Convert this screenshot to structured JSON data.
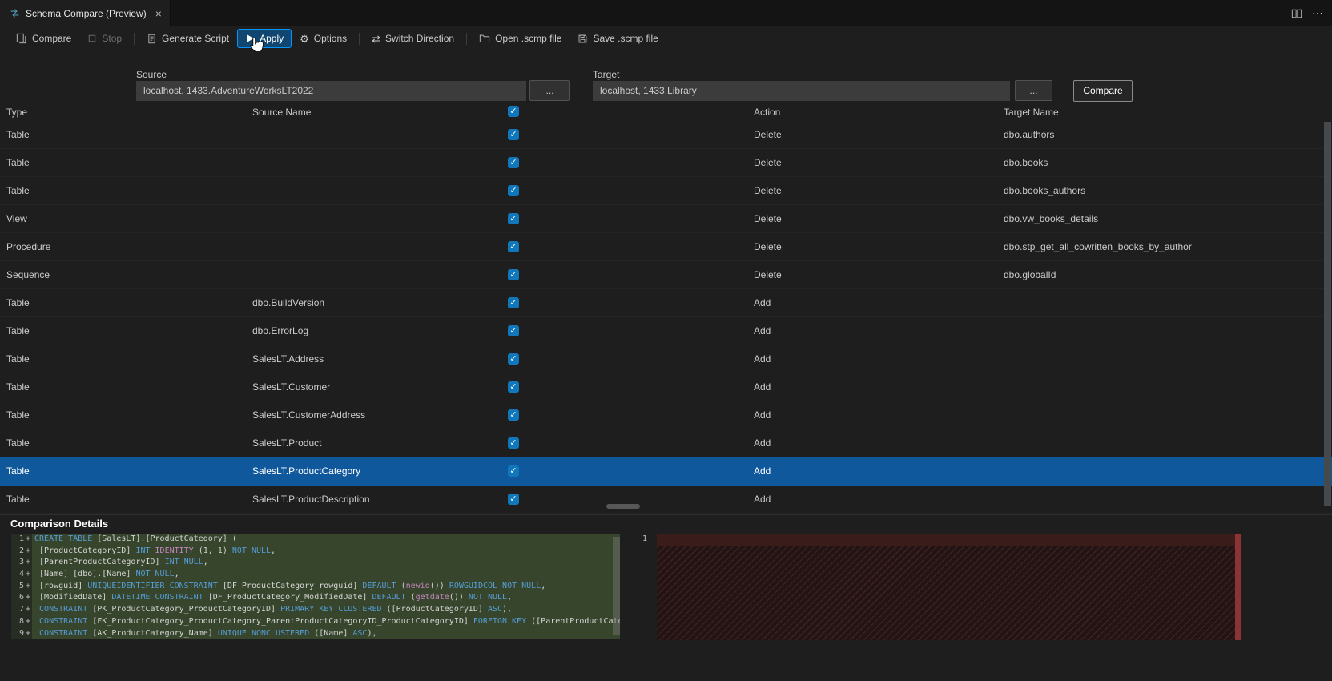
{
  "window": {
    "tab_title": "Schema Compare (Preview)",
    "tab_close": "×",
    "more_actions": "⋯"
  },
  "toolbar": {
    "compare": "Compare",
    "stop": "Stop",
    "generate_script": "Generate Script",
    "apply": "Apply",
    "options": "Options",
    "switch_direction": "Switch Direction",
    "open_scmp": "Open .scmp file",
    "save_scmp": "Save .scmp file"
  },
  "connection": {
    "source_label": "Source",
    "source_value": "localhost, 1433.AdventureWorksLT2022",
    "target_label": "Target",
    "target_value": "localhost, 1433.Library",
    "browse": "...",
    "compare_button": "Compare"
  },
  "grid": {
    "columns": {
      "type": "Type",
      "source": "Source Name",
      "action": "Action",
      "target": "Target Name"
    },
    "rows": [
      {
        "type": "Table",
        "source": "",
        "checked": true,
        "action": "Delete",
        "target": "dbo.authors",
        "selected": false
      },
      {
        "type": "Table",
        "source": "",
        "checked": true,
        "action": "Delete",
        "target": "dbo.books",
        "selected": false
      },
      {
        "type": "Table",
        "source": "",
        "checked": true,
        "action": "Delete",
        "target": "dbo.books_authors",
        "selected": false
      },
      {
        "type": "View",
        "source": "",
        "checked": true,
        "action": "Delete",
        "target": "dbo.vw_books_details",
        "selected": false
      },
      {
        "type": "Procedure",
        "source": "",
        "checked": true,
        "action": "Delete",
        "target": "dbo.stp_get_all_cowritten_books_by_author",
        "selected": false
      },
      {
        "type": "Sequence",
        "source": "",
        "checked": true,
        "action": "Delete",
        "target": "dbo.globalId",
        "selected": false
      },
      {
        "type": "Table",
        "source": "dbo.BuildVersion",
        "checked": true,
        "action": "Add",
        "target": "",
        "selected": false
      },
      {
        "type": "Table",
        "source": "dbo.ErrorLog",
        "checked": true,
        "action": "Add",
        "target": "",
        "selected": false
      },
      {
        "type": "Table",
        "source": "SalesLT.Address",
        "checked": true,
        "action": "Add",
        "target": "",
        "selected": false
      },
      {
        "type": "Table",
        "source": "SalesLT.Customer",
        "checked": true,
        "action": "Add",
        "target": "",
        "selected": false
      },
      {
        "type": "Table",
        "source": "SalesLT.CustomerAddress",
        "checked": true,
        "action": "Add",
        "target": "",
        "selected": false
      },
      {
        "type": "Table",
        "source": "SalesLT.Product",
        "checked": true,
        "action": "Add",
        "target": "",
        "selected": false
      },
      {
        "type": "Table",
        "source": "SalesLT.ProductCategory",
        "checked": true,
        "action": "Add",
        "target": "",
        "selected": true
      },
      {
        "type": "Table",
        "source": "SalesLT.ProductDescription",
        "checked": true,
        "action": "Add",
        "target": "",
        "selected": false
      }
    ]
  },
  "details": {
    "title": "Comparison Details",
    "right_first_line": "1",
    "left_lines": [
      {
        "n": "1",
        "t": [
          [
            "CREATE TABLE",
            "k"
          ],
          [
            " [SalesLT].[ProductCategory] (",
            "d"
          ]
        ]
      },
      {
        "n": "2",
        "t": [
          [
            " [ProductCategoryID] ",
            "d"
          ],
          [
            "INT ",
            "k"
          ],
          [
            "IDENTITY",
            "f"
          ],
          [
            " (1, 1) ",
            "d"
          ],
          [
            "NOT NULL",
            "k"
          ],
          [
            ",",
            "d"
          ]
        ]
      },
      {
        "n": "3",
        "t": [
          [
            " [ParentProductCategoryID] ",
            "d"
          ],
          [
            "INT NULL",
            "k"
          ],
          [
            ",",
            "d"
          ]
        ]
      },
      {
        "n": "4",
        "t": [
          [
            " [Name] [dbo].[Name] ",
            "d"
          ],
          [
            "NOT NULL",
            "k"
          ],
          [
            ",",
            "d"
          ]
        ]
      },
      {
        "n": "5",
        "t": [
          [
            " [rowguid] ",
            "d"
          ],
          [
            "UNIQUEIDENTIFIER CONSTRAINT",
            "k"
          ],
          [
            " [DF_ProductCategory_rowguid] ",
            "d"
          ],
          [
            "DEFAULT",
            "k"
          ],
          [
            " (",
            "d"
          ],
          [
            "newid",
            "f"
          ],
          [
            "()) ",
            "d"
          ],
          [
            "ROWGUIDCOL NOT NULL",
            "k"
          ],
          [
            ",",
            "d"
          ]
        ]
      },
      {
        "n": "6",
        "t": [
          [
            " [ModifiedDate] ",
            "d"
          ],
          [
            "DATETIME CONSTRAINT",
            "k"
          ],
          [
            " [DF_ProductCategory_ModifiedDate] ",
            "d"
          ],
          [
            "DEFAULT",
            "k"
          ],
          [
            " (",
            "d"
          ],
          [
            "getdate",
            "f"
          ],
          [
            "()) ",
            "d"
          ],
          [
            "NOT NULL",
            "k"
          ],
          [
            ",",
            "d"
          ]
        ]
      },
      {
        "n": "7",
        "t": [
          [
            " ",
            "d"
          ],
          [
            "CONSTRAINT",
            "k"
          ],
          [
            " [PK_ProductCategory_ProductCategoryID] ",
            "d"
          ],
          [
            "PRIMARY KEY CLUSTERED",
            "k"
          ],
          [
            " ([ProductCategoryID] ",
            "d"
          ],
          [
            "ASC",
            "k"
          ],
          [
            "),",
            "d"
          ]
        ]
      },
      {
        "n": "8",
        "t": [
          [
            " ",
            "d"
          ],
          [
            "CONSTRAINT",
            "k"
          ],
          [
            " [FK_ProductCategory_ProductCategory_ParentProductCategoryID_ProductCategoryID] ",
            "d"
          ],
          [
            "FOREIGN KEY",
            "k"
          ],
          [
            " ([ParentProductCatego",
            "d"
          ]
        ]
      },
      {
        "n": "9",
        "t": [
          [
            " ",
            "d"
          ],
          [
            "CONSTRAINT",
            "k"
          ],
          [
            " [AK_ProductCategory_Name] ",
            "d"
          ],
          [
            "UNIQUE NONCLUSTERED",
            "k"
          ],
          [
            " ([Name] ",
            "d"
          ],
          [
            "ASC",
            "k"
          ],
          [
            "),",
            "d"
          ]
        ]
      }
    ]
  },
  "colors": {
    "selection_blue": "#10589c",
    "checkbox_blue": "#1177bb",
    "apply_highlight": "#0095ff",
    "keyword_blue": "#569cd6",
    "function_magenta": "#c586c0",
    "added_line_green": "#36452b",
    "removed_red": "#3e1f1f"
  }
}
